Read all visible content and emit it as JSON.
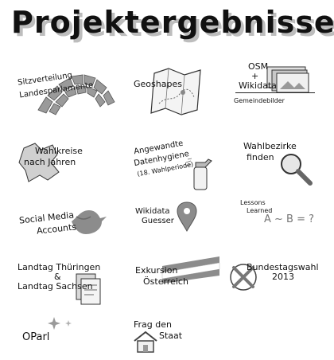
{
  "title": "Projektergebnisse",
  "items": [
    {
      "lines": [
        "Sitzverteilung",
        "Landesparlamente"
      ],
      "icon": "parliament-seats-icon"
    },
    {
      "lines": [
        "Geoshapes"
      ],
      "icon": "map-icon"
    },
    {
      "lines": [
        "OSM",
        "+",
        "Wikidata",
        "Gemeindebilder"
      ],
      "icon": "photos-icon"
    },
    {
      "lines": [
        "Wahlkreise",
        "nach Jahren"
      ],
      "icon": "region-map-icon"
    },
    {
      "lines": [
        "Angewandte",
        "Datenhygiene",
        "(18. Wahlperiode)"
      ],
      "icon": "spray-bottle-icon"
    },
    {
      "lines": [
        "Wahlbezirke",
        "finden"
      ],
      "icon": "magnifier-icon"
    },
    {
      "lines": [
        "Social Media",
        "Accounts"
      ],
      "icon": "bird-icon"
    },
    {
      "lines": [
        "Wikidata",
        "Guesser"
      ],
      "icon": "location-pin-icon"
    },
    {
      "lines": [
        "Lessons",
        "Learned",
        "A ~ B = ?"
      ],
      "icon": "question-icon"
    },
    {
      "lines": [
        "Landtag Thüringen",
        "&",
        "Landtag Sachsen"
      ],
      "icon": "documents-icon"
    },
    {
      "lines": [
        "Exkursion",
        "Österreich"
      ],
      "icon": "austria-flag-icon"
    },
    {
      "lines": [
        "Bundestagswahl",
        "2013"
      ],
      "icon": "ballot-cross-icon"
    },
    {
      "lines": [
        "OParl"
      ],
      "icon": "sparkle-icon"
    },
    {
      "lines": [
        "Frag den",
        "Staat"
      ],
      "icon": "house-icon"
    }
  ]
}
